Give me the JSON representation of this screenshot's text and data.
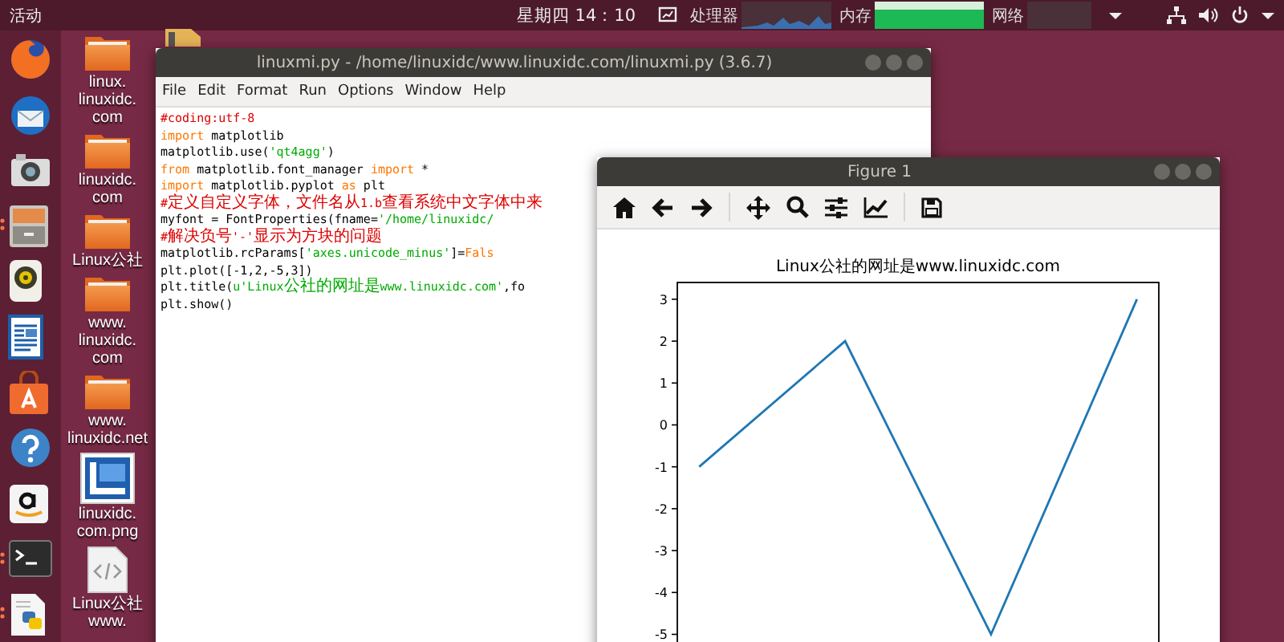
{
  "top_bar": {
    "activities": "活动",
    "clock": "星期四 14：10",
    "cpu_label": "处理器",
    "memory_label": "内存",
    "network_label": "网络"
  },
  "dock": [
    {
      "kind": "browser",
      "running": false
    },
    {
      "kind": "mail",
      "running": false
    },
    {
      "kind": "camera",
      "running": false
    },
    {
      "kind": "files",
      "running": true
    },
    {
      "kind": "speaker",
      "running": false
    },
    {
      "kind": "writer",
      "running": false
    },
    {
      "kind": "store",
      "running": false
    },
    {
      "kind": "help",
      "running": false
    },
    {
      "kind": "amazon",
      "running": false
    },
    {
      "kind": "terminal",
      "running": true
    },
    {
      "kind": "python",
      "running": true
    }
  ],
  "desktop_icons": [
    {
      "kind": "folder",
      "label": "linux.\nlinuxidc.\ncom"
    },
    {
      "kind": "folder",
      "label": "linuxidc.\ncom"
    },
    {
      "kind": "folder",
      "label": "Linux公社"
    },
    {
      "kind": "folder",
      "label": "www.\nlinuxidc.\ncom"
    },
    {
      "kind": "folder",
      "label": "www.\nlinuxidc.net"
    },
    {
      "kind": "image",
      "label": "linuxidc.\ncom.png"
    },
    {
      "kind": "code",
      "label": "Linux公社\nwww."
    }
  ],
  "editor": {
    "title": "linuxmi.py - /home/linuxidc/www.linuxidc.com/linuxmi.py (3.6.7)",
    "menu": [
      "File",
      "Edit",
      "Format",
      "Run",
      "Options",
      "Window",
      "Help"
    ],
    "code": [
      [
        {
          "kind": "comment",
          "text": "#coding:utf-8"
        }
      ],
      [
        {
          "kind": "keyword",
          "text": "import"
        },
        {
          "kind": "plain",
          "text": " matplotlib"
        }
      ],
      [
        {
          "kind": "plain",
          "text": "matplotlib.use("
        },
        {
          "kind": "string",
          "text": "'qt4agg'"
        },
        {
          "kind": "plain",
          "text": ")"
        }
      ],
      [
        {
          "kind": "keyword",
          "text": "from"
        },
        {
          "kind": "plain",
          "text": " matplotlib.font_manager "
        },
        {
          "kind": "keyword",
          "text": "import"
        },
        {
          "kind": "plain",
          "text": " *"
        }
      ],
      [
        {
          "kind": "keyword",
          "text": "import"
        },
        {
          "kind": "plain",
          "text": " matplotlib.pyplot "
        },
        {
          "kind": "keyword",
          "text": "as"
        },
        {
          "kind": "plain",
          "text": " plt"
        }
      ],
      [
        {
          "kind": "comment",
          "text": "#定义自定义字体，文件名从1.b查看系统中文字体中来"
        }
      ],
      [
        {
          "kind": "plain",
          "text": "myfont = FontProperties(fname="
        },
        {
          "kind": "string",
          "text": "'/home/linuxidc/"
        }
      ],
      [
        {
          "kind": "comment",
          "text": "#解决负号'-'显示为方块的问题"
        }
      ],
      [
        {
          "kind": "plain",
          "text": "matplotlib.rcParams["
        },
        {
          "kind": "string",
          "text": "'axes.unicode_minus'"
        },
        {
          "kind": "plain",
          "text": "]="
        },
        {
          "kind": "keyword",
          "text": "Fals"
        }
      ],
      [
        {
          "kind": "plain",
          "text": "plt.plot([-1,2,-5,3])"
        }
      ],
      [
        {
          "kind": "plain",
          "text": "plt.title("
        },
        {
          "kind": "string",
          "text": "u'Linux公社的网址是www.linuxidc.com'"
        },
        {
          "kind": "plain",
          "text": ",fo"
        }
      ],
      [
        {
          "kind": "plain",
          "text": "plt.show()"
        }
      ]
    ]
  },
  "figure": {
    "title": "Figure 1",
    "toolbar": [
      {
        "kind": "home"
      },
      {
        "kind": "back"
      },
      {
        "kind": "forward"
      },
      {
        "kind": "separator"
      },
      {
        "kind": "pan"
      },
      {
        "kind": "zoom"
      },
      {
        "kind": "configure"
      },
      {
        "kind": "edit"
      },
      {
        "kind": "separator"
      },
      {
        "kind": "save"
      }
    ],
    "chart_data": {
      "type": "line",
      "title": "Linux公社的网址是www.linuxidc.com",
      "categories": [
        null,
        null,
        null,
        null
      ],
      "ylim": [
        -5.4,
        3.4
      ],
      "yticks": [
        3,
        2,
        1,
        0,
        -1,
        -2,
        -3,
        -4,
        -5
      ],
      "series": [
        {
          "color": "#1f77b4",
          "values": [
            -1,
            2,
            -5,
            3
          ]
        }
      ]
    }
  }
}
